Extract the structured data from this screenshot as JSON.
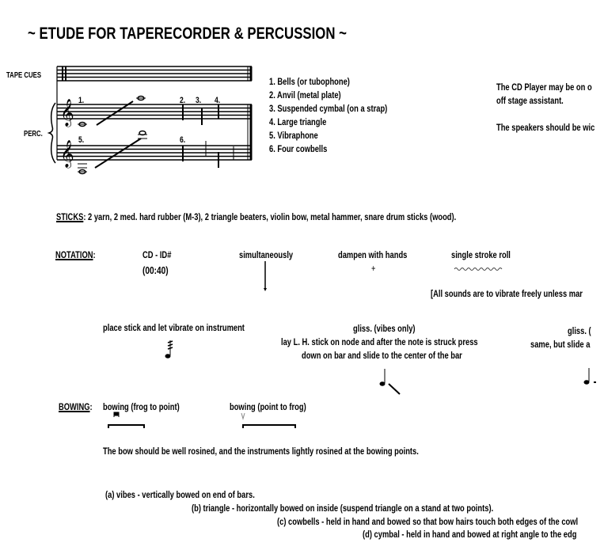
{
  "title": "~ ETUDE FOR TAPERECORDER & PERCUSSION ~",
  "score": {
    "tape_label": "TAPE CUES",
    "perc_label": "PERC.",
    "marks": [
      "1.",
      "2.",
      "3.",
      "4.",
      "5.",
      "6."
    ]
  },
  "instruments": [
    "1. Bells (or tubophone)",
    "2. Anvil (metal plate)",
    "3. Suspended cymbal (on a strap)",
    "4. Large triangle",
    "5. Vibraphone",
    "6. Four cowbells"
  ],
  "side_notes": {
    "line1": "The CD Player may be on o",
    "line2": "off stage assistant.",
    "line3": "The speakers should be wic"
  },
  "sticks": {
    "label": "STICKS",
    "text": ": 2 yarn, 2 med. hard rubber (M-3), 2 triangle beaters, violin bow, metal hammer, snare drum sticks (wood)."
  },
  "notation": {
    "label": "NOTATION",
    "colon": ":",
    "cd_id": "CD - ID#",
    "time": "(00:40)",
    "simultaneously": "simultaneously",
    "dampen": "dampen with hands",
    "dampen_symbol": "+",
    "roll": "single stroke roll",
    "free_note": "[All sounds are to vibrate freely unless mar",
    "place_stick": "place stick and let vibrate on instrument",
    "gliss_title": "gliss. (vibes only)",
    "gliss_line1": "lay L. H. stick on node and after the note is struck press",
    "gliss_line2": "down on bar and slide to the center of the bar",
    "gliss2_title": "gliss. (",
    "gliss2_line1": "same, but slide a"
  },
  "bowing": {
    "label": "BOWING",
    "colon": ":",
    "frog_to_point": "bowing (frog to point)",
    "point_to_frog": "bowing (point to frog)",
    "rosin": "The bow should be well rosined, and the instruments lightly rosined at the bowing points.",
    "items": [
      "(a) vibes - vertically bowed on end of bars.",
      "(b) triangle - horizontally bowed on inside (suspend triangle on a stand at two points).",
      "(c) cowbells - held in hand and bowed so that bow hairs touch both edges of the cowl",
      "(d) cymbal - held in hand and bowed at right angle to the edg"
    ]
  }
}
